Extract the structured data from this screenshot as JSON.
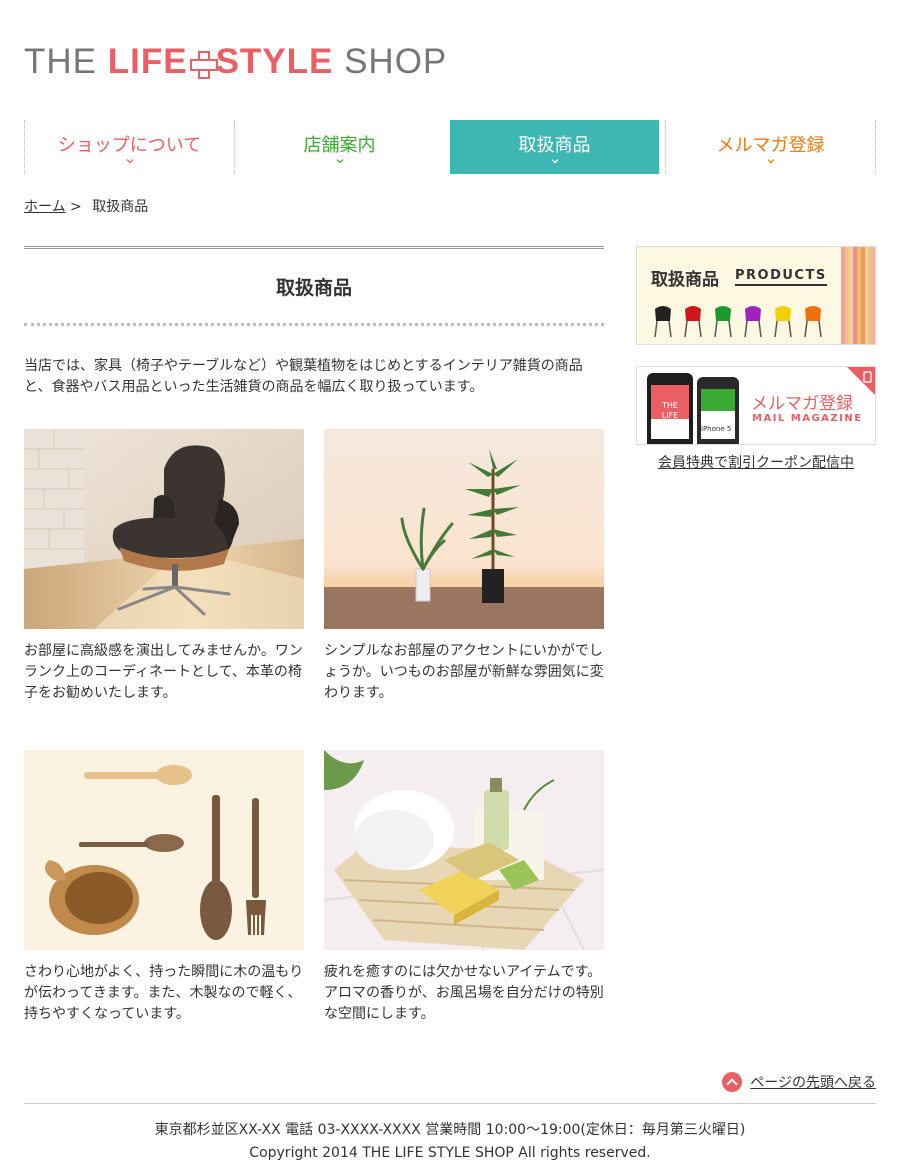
{
  "logo": {
    "part1": "THE ",
    "part2": "LIFE",
    "part3": "STYLE",
    "part4": " SHOP"
  },
  "nav": [
    {
      "label": "ショップについて",
      "color": "#e95f63"
    },
    {
      "label": "店舗案内",
      "color": "#3aaa35"
    },
    {
      "label": "取扱商品",
      "color": "#ffffff",
      "active": true,
      "bg": "#3eb7b3"
    },
    {
      "label": "メルマガ登録",
      "color": "#ef7a14"
    }
  ],
  "breadcrumb": {
    "home": "ホーム",
    "sep": " > ",
    "current": "取扱商品"
  },
  "page_title": "取扱商品",
  "intro": "当店では、家具（椅子やテーブルなど）や観葉植物をはじめとするインテリア雑貨の商品と、食器やバス用品といった生活雑貨の商品を幅広く取り扱っています。",
  "products": [
    {
      "text": "お部屋に高級感を演出してみませんか。ワンランク上のコーディネートとして、本革の椅子をお勧めいたします。",
      "image": "leather-lounge-chair"
    },
    {
      "text": "シンプルなお部屋のアクセントにいかがでしょうか。いつものお部屋が新鮮な雰囲気に変わります。",
      "image": "potted-plants"
    },
    {
      "text": "さわり心地がよく、持った瞬間に木の温もりが伝わってきます。また、木製なので軽く、持ちやすくなっています。",
      "image": "wooden-utensils"
    },
    {
      "text": "疲れを癒すのには欠かせないアイテムです。アロマの香りが、お風呂場を自分だけの特別な空間にします。",
      "image": "bath-basket"
    }
  ],
  "sidebar": {
    "products_banner": {
      "title": "取扱商品",
      "subtitle": "PRODUCTS"
    },
    "mail_banner": {
      "title": "メルマガ登録",
      "subtitle": "MAIL MAGAZINE",
      "phone_text": "THE LIFE",
      "phone_text2": "iPhone 5"
    },
    "mail_link": "会員特典で割引クーポン配信中"
  },
  "totop": "ページの先頭へ戻る",
  "footer": {
    "address": "東京都杉並区XX-XX 電話 03-XXXX-XXXX 営業時間 10:00～19:00(定休日：毎月第三火曜日)",
    "copyright": "Copyright 2014 THE LIFE STYLE SHOP All rights reserved."
  },
  "colors": {
    "accent_red": "#e95f63",
    "accent_teal": "#3eb7b3",
    "accent_green": "#3aaa35",
    "accent_orange": "#ef7a14"
  }
}
